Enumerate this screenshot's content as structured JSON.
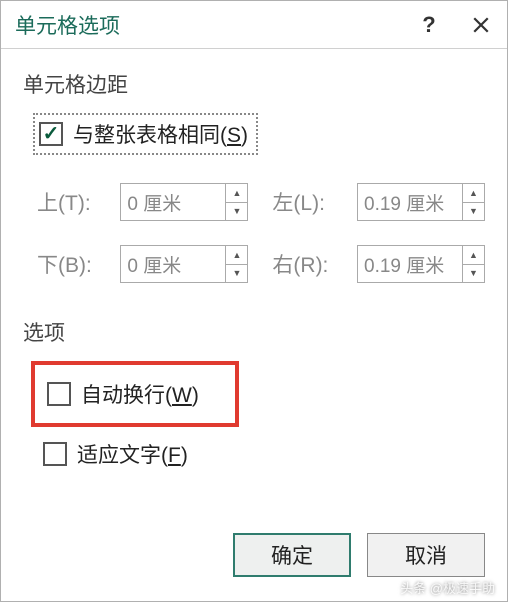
{
  "title": "单元格选项",
  "sections": {
    "margins_label": "单元格边距",
    "options_label": "选项"
  },
  "checkboxes": {
    "same_as_table": {
      "label": "与整张表格相同(",
      "accel": "S",
      "tail": ")",
      "checked": true
    },
    "wrap_text": {
      "label": "自动换行(",
      "accel": "W",
      "tail": ")",
      "checked": false
    },
    "fit_text": {
      "label": "适应文字(",
      "accel": "F",
      "tail": ")",
      "checked": false
    }
  },
  "margins": {
    "top": {
      "label": "上(T):",
      "value": "0 厘米"
    },
    "left": {
      "label": "左(L):",
      "value": "0.19 厘米"
    },
    "bottom": {
      "label": "下(B):",
      "value": "0 厘米"
    },
    "right": {
      "label": "右(R):",
      "value": "0.19 厘米"
    }
  },
  "buttons": {
    "ok": "确定",
    "cancel": "取消"
  },
  "watermark": "头条 @极速手助"
}
